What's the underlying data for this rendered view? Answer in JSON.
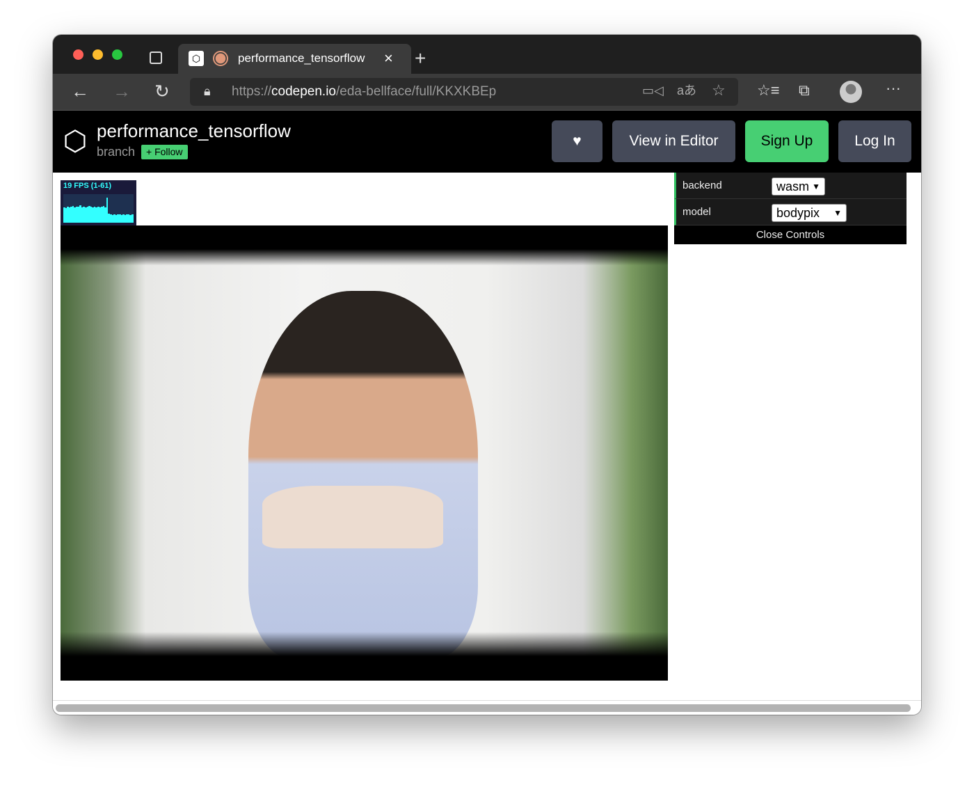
{
  "browser": {
    "tab_title": "performance_tensorflow",
    "url_prefix": "https://",
    "url_domain": "codepen.io",
    "url_path": "/eda-bellface/full/KKXKBEp"
  },
  "codepen": {
    "title": "performance_tensorflow",
    "author": "branch",
    "follow_label": "Follow",
    "view_in_editor": "View in Editor",
    "sign_up": "Sign Up",
    "log_in": "Log In"
  },
  "stats": {
    "fps_label": "19 FPS (1-61)",
    "history": [
      38,
      36,
      40,
      37,
      39,
      41,
      38,
      40,
      39,
      42,
      38,
      40,
      37,
      39,
      41,
      40,
      38,
      39,
      37,
      40,
      38,
      39,
      41,
      38,
      62,
      22,
      20,
      19,
      20,
      19,
      21,
      20,
      19,
      20,
      19,
      20,
      21,
      19,
      20
    ]
  },
  "controls": {
    "backend_label": "backend",
    "backend_value": "wasm",
    "model_label": "model",
    "model_value": "bodypix",
    "close_label": "Close Controls"
  },
  "colors": {
    "accent_green": "#47cf73",
    "fps_cyan": "#3ff"
  }
}
